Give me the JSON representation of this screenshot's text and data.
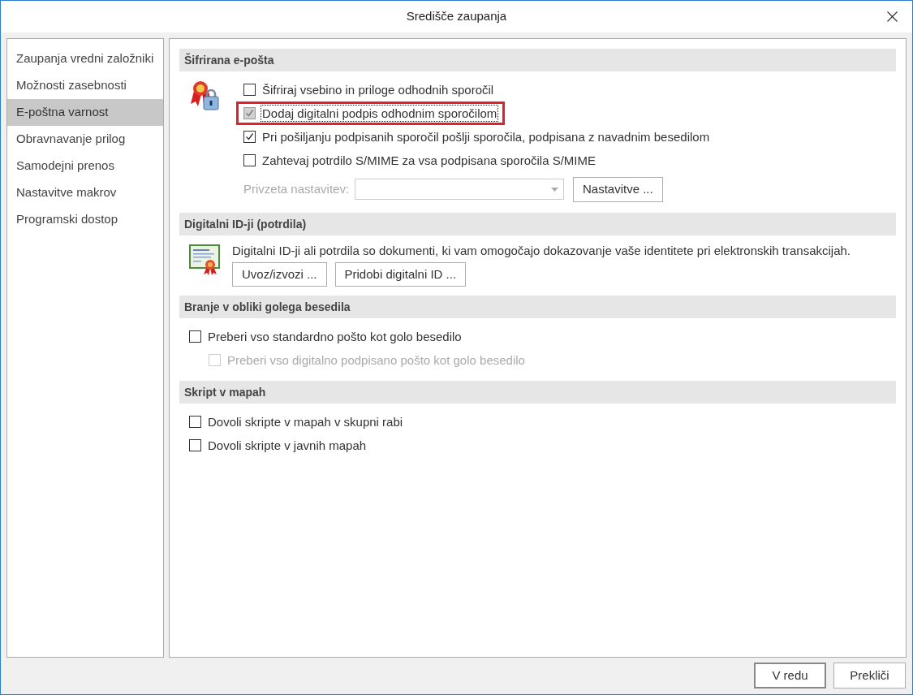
{
  "window": {
    "title": "Središče zaupanja"
  },
  "sidebar": {
    "items": [
      {
        "label": "Zaupanja vredni založniki",
        "selected": false
      },
      {
        "label": "Možnosti zasebnosti",
        "selected": false
      },
      {
        "label": "E-poštna varnost",
        "selected": true
      },
      {
        "label": "Obravnavanje prilog",
        "selected": false
      },
      {
        "label": "Samodejni prenos",
        "selected": false
      },
      {
        "label": "Nastavitve makrov",
        "selected": false
      },
      {
        "label": "Programski dostop",
        "selected": false
      }
    ]
  },
  "sections": [
    {
      "title": "Šifrirana e-pošta",
      "items": [
        {
          "kind": "checkbox",
          "label": "Šifriraj vsebino in priloge odhodnih sporočil",
          "checked": false,
          "disabled": false,
          "focused": false,
          "highlighted": false
        },
        {
          "kind": "checkbox",
          "label": "Dodaj digitalni podpis odhodnim sporočilom",
          "checked": true,
          "disabled": false,
          "focused": true,
          "highlighted": true
        },
        {
          "kind": "checkbox",
          "label": "Pri pošiljanju podpisanih sporočil pošlji sporočila, podpisana z navadnim besedilom",
          "checked": true,
          "disabled": false,
          "focused": false,
          "highlighted": false
        },
        {
          "kind": "checkbox",
          "label": "Zahtevaj potrdilo S/MIME za vsa podpisana sporočila S/MIME",
          "checked": false,
          "disabled": false,
          "focused": false,
          "highlighted": false
        },
        {
          "kind": "combo",
          "label": "Privzeta nastavitev:",
          "disabled": true,
          "button": "Nastavitve ..."
        }
      ]
    },
    {
      "title": "Digitalni ID-ji (potrdila)",
      "items": [
        {
          "kind": "text",
          "text": "Digitalni ID-ji ali potrdila so dokumenti, ki vam omogočajo dokazovanje vaše identitete pri elektronskih transakcijah."
        },
        {
          "kind": "buttons",
          "buttons": [
            "Uvoz/izvozi ...",
            "Pridobi digitalni ID ..."
          ]
        }
      ]
    },
    {
      "title": "Branje v obliki golega besedila",
      "items": [
        {
          "kind": "checkbox",
          "label": "Preberi vso standardno pošto kot golo besedilo",
          "checked": false,
          "disabled": false,
          "focused": false,
          "highlighted": false,
          "children": [
            {
              "kind": "checkbox",
              "label": "Preberi vso digitalno podpisano pošto kot golo besedilo",
              "checked": false,
              "disabled": true,
              "focused": false,
              "highlighted": false
            }
          ]
        }
      ]
    },
    {
      "title": "Skript v mapah",
      "items": [
        {
          "kind": "checkbox",
          "label": "Dovoli skripte v mapah v skupni rabi",
          "checked": false,
          "disabled": false,
          "focused": false,
          "highlighted": false
        },
        {
          "kind": "checkbox",
          "label": "Dovoli skripte v javnih mapah",
          "checked": false,
          "disabled": false,
          "focused": false,
          "highlighted": false
        }
      ]
    }
  ],
  "buttons": [
    "V redu",
    "Prekliči"
  ]
}
